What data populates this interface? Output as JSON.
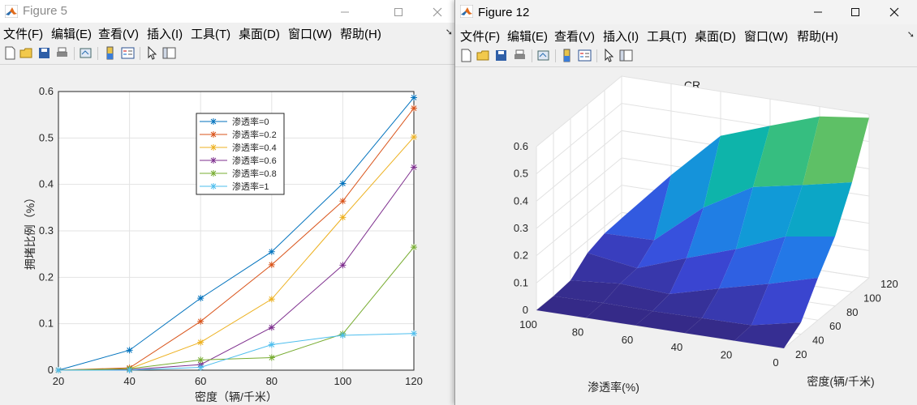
{
  "fig5": {
    "title": "Figure 5",
    "menu": [
      "文件(F)",
      "编辑(E)",
      "查看(V)",
      "插入(I)",
      "工具(T)",
      "桌面(D)",
      "窗口(W)",
      "帮助(H)"
    ],
    "toolbar_icons": [
      "new-file-icon",
      "open-folder-icon",
      "save-icon",
      "print-icon",
      "link-icon",
      "colorbar-icon",
      "legend-icon",
      "pointer-icon",
      "property-editor-icon"
    ],
    "window_controls": [
      "minimize-icon",
      "maximize-icon",
      "close-icon"
    ]
  },
  "fig12": {
    "title": "Figure 12",
    "menu": [
      "文件(F)",
      "编辑(E)",
      "查看(V)",
      "插入(I)",
      "工具(T)",
      "桌面(D)",
      "窗口(W)",
      "帮助(H)"
    ],
    "toolbar_icons": [
      "new-file-icon",
      "open-folder-icon",
      "save-icon",
      "print-icon",
      "link-icon",
      "colorbar-icon",
      "legend-icon",
      "pointer-icon",
      "property-editor-icon"
    ],
    "window_controls": [
      "minimize-icon",
      "maximize-icon",
      "close-icon"
    ]
  },
  "chart_data": [
    {
      "type": "line",
      "title": "",
      "xlabel": "密度（辆/千米）",
      "ylabel": "拥堵比例（%）",
      "x": [
        20,
        40,
        60,
        80,
        100,
        120
      ],
      "xlim": [
        20,
        120
      ],
      "ylim": [
        0,
        0.6
      ],
      "xticks": [
        "20",
        "40",
        "60",
        "80",
        "100",
        "120"
      ],
      "yticks": [
        "0",
        "0.1",
        "0.2",
        "0.3",
        "0.4",
        "0.5",
        "0.6"
      ],
      "grid": true,
      "legend_position": "top-center",
      "marker": "asterisk",
      "series": [
        {
          "name": "渗透率=0",
          "color": "#0072BD",
          "values": [
            0,
            0.043,
            0.155,
            0.255,
            0.402,
            0.587
          ]
        },
        {
          "name": "渗透率=0.2",
          "color": "#D95319",
          "values": [
            0,
            0.005,
            0.105,
            0.227,
            0.364,
            0.564
          ]
        },
        {
          "name": "渗透率=0.4",
          "color": "#EDB120",
          "values": [
            0,
            0.003,
            0.06,
            0.153,
            0.329,
            0.502
          ]
        },
        {
          "name": "渗透率=0.6",
          "color": "#7E2F8E",
          "values": [
            0,
            0.001,
            0.012,
            0.092,
            0.226,
            0.437
          ]
        },
        {
          "name": "渗透率=0.8",
          "color": "#77AC30",
          "values": [
            0,
            0.003,
            0.022,
            0.027,
            0.078,
            0.265
          ]
        },
        {
          "name": "渗透率=1",
          "color": "#4DBEEE",
          "values": [
            0,
            0.0,
            0.006,
            0.055,
            0.075,
            0.079
          ]
        }
      ]
    },
    {
      "type": "surface",
      "title": "CR",
      "xlabel": "渗透率(%)",
      "ylabel": "密度(辆/千米)",
      "x": [
        0,
        20,
        40,
        60,
        80,
        100
      ],
      "y": [
        20,
        40,
        60,
        80,
        100,
        120
      ],
      "xticks": [
        "100",
        "80",
        "60",
        "40",
        "20",
        "0"
      ],
      "yticks": [
        "20",
        "40",
        "60",
        "80",
        "100",
        "120"
      ],
      "zticks": [
        "0",
        "0.1",
        "0.2",
        "0.3",
        "0.4",
        "0.5",
        "0.6"
      ],
      "zlim": [
        0,
        0.6
      ],
      "grid": true,
      "colormap": "parula",
      "z": [
        [
          0,
          0.043,
          0.155,
          0.255,
          0.402,
          0.587
        ],
        [
          0,
          0.005,
          0.105,
          0.227,
          0.364,
          0.564
        ],
        [
          0,
          0.003,
          0.06,
          0.153,
          0.329,
          0.502
        ],
        [
          0,
          0.001,
          0.012,
          0.092,
          0.226,
          0.437
        ],
        [
          0,
          0.003,
          0.022,
          0.027,
          0.078,
          0.265
        ],
        [
          0,
          0.0,
          0.006,
          0.055,
          0.075,
          0.079
        ]
      ]
    }
  ]
}
